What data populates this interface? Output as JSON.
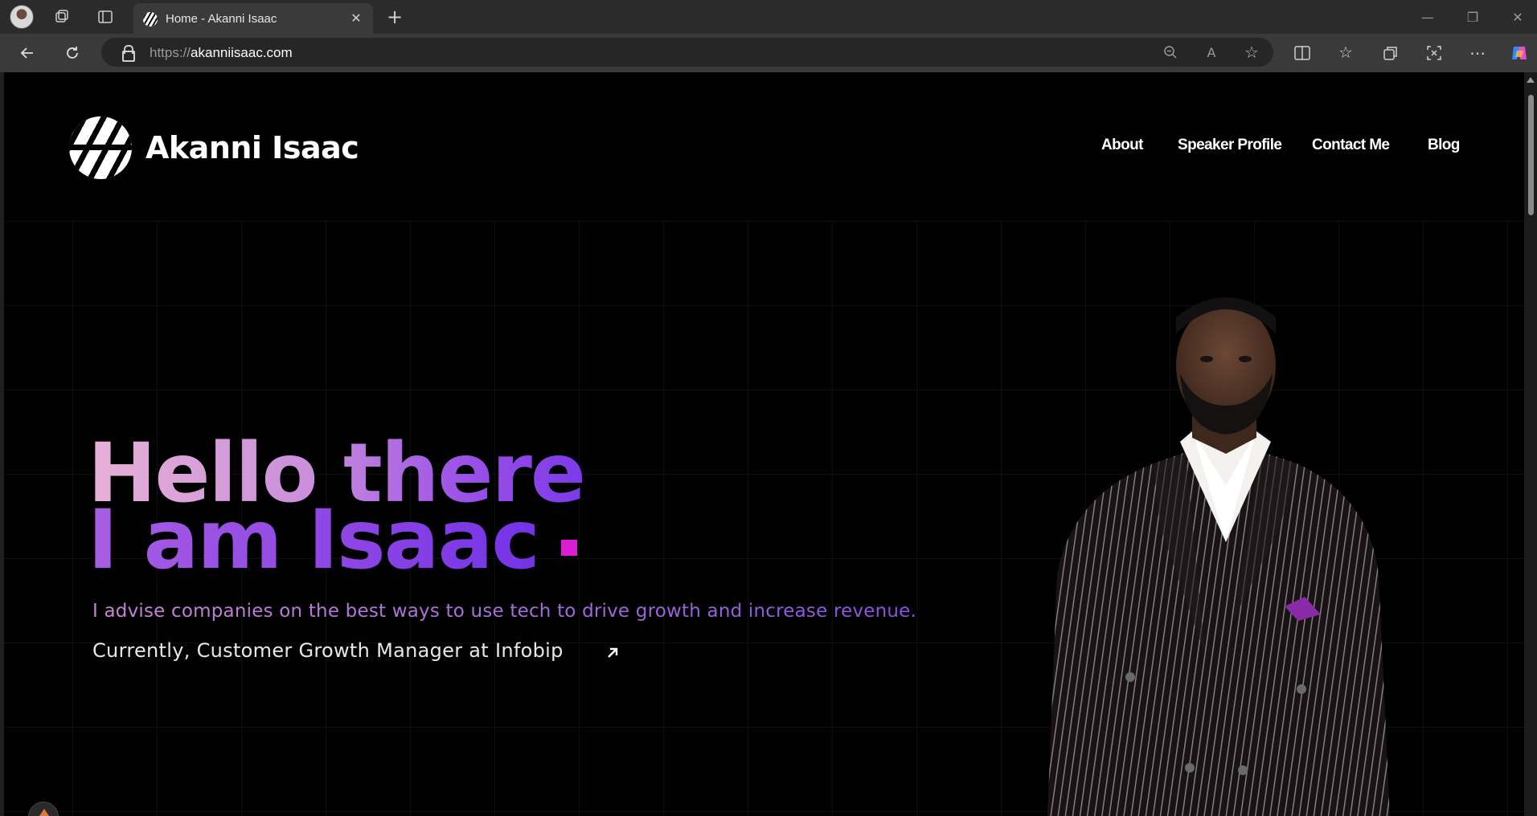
{
  "browser": {
    "tab_title": "Home - Akanni Isaac",
    "url_scheme": "https://",
    "url_host": "akanniisaac.com",
    "icons": {
      "profile": "profile-avatar-icon",
      "workspaces": "workspaces-icon",
      "tab_actions": "tab-actions-icon",
      "new_tab": "plus-icon",
      "back": "back-arrow-icon",
      "refresh": "refresh-icon",
      "zoom": "zoom-out-icon",
      "read_aloud": "read-aloud-icon",
      "favorite": "star-icon",
      "split": "split-screen-icon",
      "favorites": "favorites-icon",
      "collections": "collections-icon",
      "screenshot": "screenshot-icon",
      "menu": "more-icon",
      "copilot": "copilot-icon",
      "minimize": "minimize-icon",
      "restore": "restore-icon",
      "close": "close-icon"
    }
  },
  "site": {
    "brand": "Akanni Isaac",
    "nav": [
      {
        "label": "About"
      },
      {
        "label": "Speaker Profile"
      },
      {
        "label": "Contact Me"
      },
      {
        "label": "Blog"
      }
    ],
    "hero": {
      "line1": "Hello there",
      "line2": "I am Isaac",
      "subtitle": "I advise companies on the best ways to use tech to drive growth and increase revenue.",
      "current": "Currently, Customer Growth Manager at Infobip"
    },
    "colors": {
      "background": "#000000",
      "gradient_start": "#e7b1d7",
      "gradient_end": "#7b3ae8",
      "dot": "#d81fd2"
    }
  }
}
